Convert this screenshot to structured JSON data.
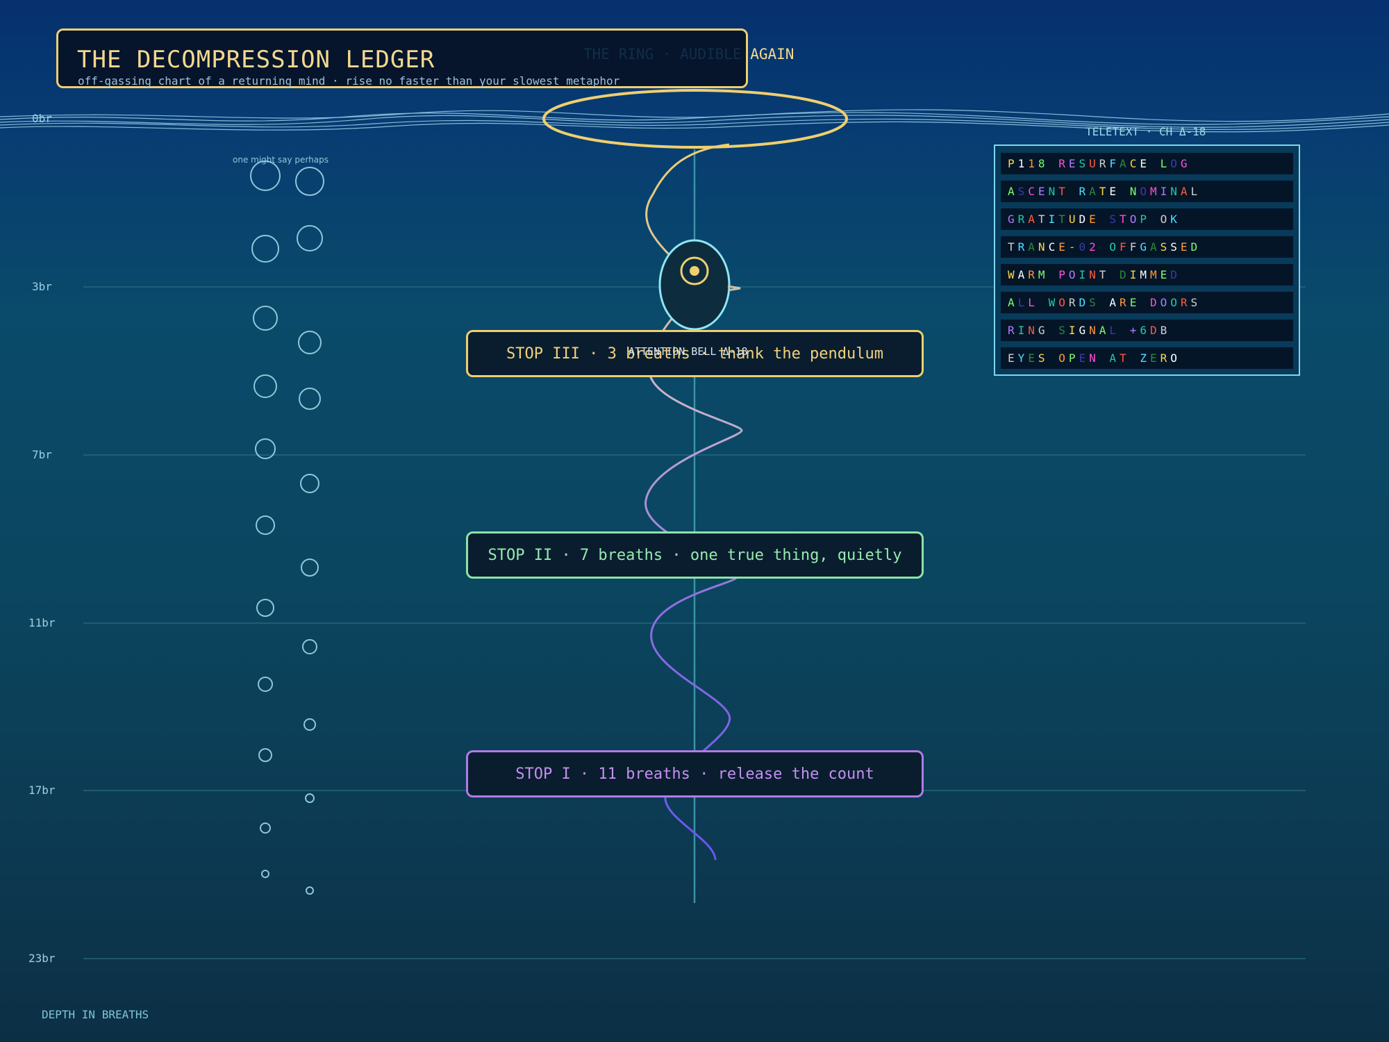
{
  "header": {
    "title": "THE DECOMPRESSION LEDGER",
    "subtitle": "off-gassing chart of a returning mind · rise no faster than your slowest metaphor"
  },
  "ring_caption": {
    "dim": "THE RING · AUDIBLE ",
    "bright": "AGAIN"
  },
  "depth_axis": {
    "title": "DEPTH IN BREATHS",
    "labels": [
      "0br",
      "3br",
      "7br",
      "11br",
      "17br",
      "23br"
    ]
  },
  "bubble_note": "one might say perhaps",
  "bell_label": "ATTENTION BELL Δ-18",
  "stops": [
    {
      "text": "STOP III · 3 breaths · thank the pendulum",
      "color": "#f0cf6e"
    },
    {
      "text": "STOP II · 7 breaths · one true thing, quietly",
      "color": "#8de3a7"
    },
    {
      "text": "STOP I · 11 breaths · release the count",
      "color": "#b27be8"
    }
  ],
  "teletext": {
    "title": "TELETEXT · CH Δ-18",
    "rows": [
      "P118 RESURFACE LOG",
      "ASCENT RATE NOMINAL",
      "GRATITUDE STOP OK",
      "TRANCE-02 OFFGASSED",
      "WARM POINT DIMMED",
      "ALL WORDS ARE DOORS",
      "RING SIGNAL +6DB",
      "EYES OPEN AT ZERO"
    ]
  },
  "colors": {
    "gold": "#f0cf6e",
    "green": "#8de3a7",
    "violet": "#b27be8",
    "cyan": "#7fd7ee"
  }
}
